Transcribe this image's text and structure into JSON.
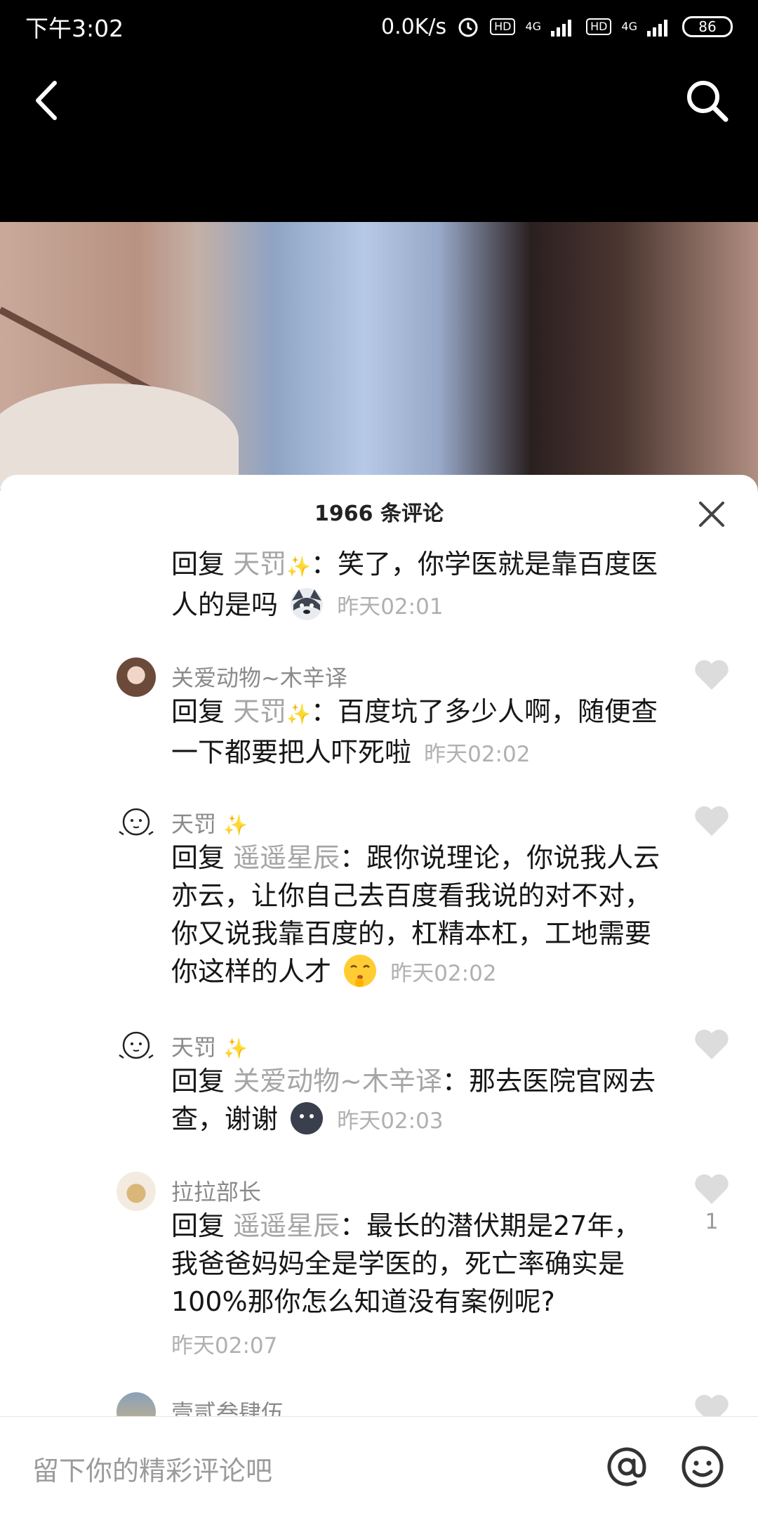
{
  "status_bar": {
    "time": "下午3:02",
    "speed": "0.0K/s",
    "hd1": "HD",
    "net1": "4G",
    "hd2": "HD",
    "net2": "4G",
    "battery": "86"
  },
  "sheet": {
    "title": "1966 条评论"
  },
  "comments": [
    {
      "reply_prefix": "回复",
      "reply_to": "天罚",
      "text": "：笑了，你学医就是靠百度医人的是吗",
      "time": "昨天02:01"
    },
    {
      "author": "关爱动物~木辛译",
      "reply_prefix": "回复",
      "reply_to": "天罚",
      "text": "：百度坑了多少人啊，随便查一下都要把人吓死啦",
      "time": "昨天02:02"
    },
    {
      "author": "天罚",
      "reply_prefix": "回复",
      "reply_to": "遥遥星辰",
      "text": "：跟你说理论，你说我人云亦云，让你自己去百度看我说的对不对，你又说我靠百度的，杠精本杠，工地需要你这样的人才",
      "time": "昨天02:02"
    },
    {
      "author": "天罚",
      "reply_prefix": "回复",
      "reply_to": "关爱动物~木辛译",
      "text": "：那去医院官网去查，谢谢",
      "time": "昨天02:03"
    },
    {
      "author": "拉拉部长",
      "reply_prefix": "回复",
      "reply_to": "遥遥星辰",
      "text": "：最长的潜伏期是27年，我爸爸妈妈全是学医的，死亡率确实是100%那你怎么知道没有案例呢?",
      "time": "昨天02:07",
      "likes": "1"
    },
    {
      "author": "壹贰叁肆伍"
    }
  ],
  "input": {
    "placeholder": "留下你的精彩评论吧"
  },
  "icons": [
    "back-icon",
    "search-icon",
    "close-icon",
    "heart-icon",
    "at-icon",
    "emoji-icon",
    "alarm-icon",
    "signal-icon"
  ],
  "colors": {
    "mention": "#a5a5a5",
    "time": "#b0b0b0",
    "sparkle": "#f2cf55"
  }
}
